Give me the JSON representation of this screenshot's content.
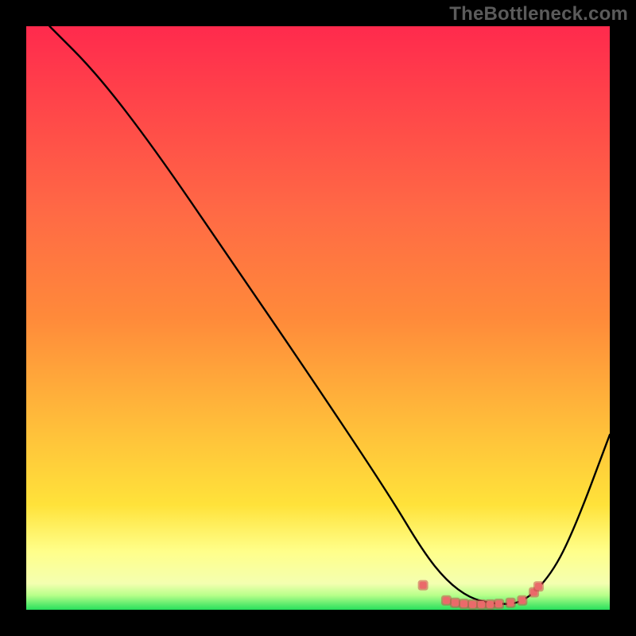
{
  "watermark": "TheBottleneck.com",
  "colors": {
    "background": "#000000",
    "gradient_top": "#ff2a4d",
    "gradient_mid_orange": "#ff8a3a",
    "gradient_mid_yellow": "#ffe23a",
    "gradient_light_yellow": "#ffff8a",
    "gradient_bottom": "#27e05c",
    "curve": "#000000",
    "marker_fill": "#ea6a6a",
    "marker_stroke": "#c94a4a"
  },
  "chart_data": {
    "type": "line",
    "title": "",
    "xlabel": "",
    "ylabel": "",
    "xlim": [
      0,
      100
    ],
    "ylim": [
      0,
      100
    ],
    "curve": {
      "x": [
        4,
        12,
        22,
        35,
        48,
        62,
        68,
        72,
        76,
        80,
        85,
        90,
        94,
        100
      ],
      "y": [
        100,
        92,
        79,
        60,
        41,
        20,
        10,
        5,
        2,
        1,
        1,
        6,
        14,
        30
      ]
    },
    "markers": {
      "x": [
        68,
        72,
        73.5,
        75,
        76.5,
        78,
        79.5,
        81,
        83,
        85,
        87,
        87.8
      ],
      "y": [
        4.2,
        1.6,
        1.2,
        1.0,
        0.9,
        0.9,
        0.9,
        1.0,
        1.2,
        1.6,
        3.0,
        4.0
      ]
    }
  }
}
